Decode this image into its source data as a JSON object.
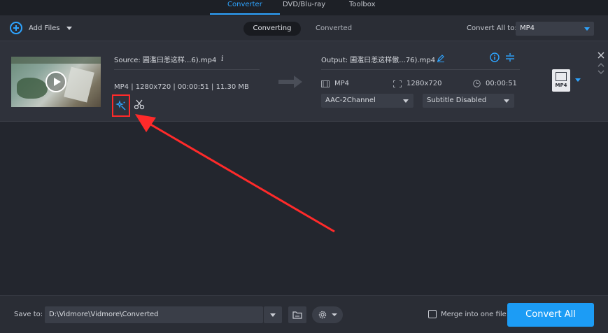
{
  "nav": {
    "tabs": [
      {
        "label": "Converter"
      },
      {
        "label": "DVD/Blu-ray"
      },
      {
        "label": "Toolbox"
      }
    ]
  },
  "toolbar": {
    "add_files_label": "Add Files",
    "segments": {
      "converting": "Converting",
      "converted": "Converted"
    },
    "convert_all_to_label": "Convert All to:",
    "convert_all_format": "MP4"
  },
  "file": {
    "source_name": "Source: 圃濫曰恙这样...6).mp4",
    "source_meta": "MP4 | 1280x720 | 00:00:51 | 11.30 MB",
    "output_name": "Output: 圃濫曰恙这样傲...76).mp4",
    "output_format": "MP4",
    "output_resolution": "1280x720",
    "output_duration": "00:00:51",
    "audio_track": "AAC-2Channel",
    "subtitle": "Subtitle Disabled",
    "format_badge": "MP4"
  },
  "bottom": {
    "save_to_label": "Save to:",
    "save_path": "D:\\Vidmore\\Vidmore\\Converted",
    "merge_label": "Merge into one file",
    "convert_all_label": "Convert All"
  },
  "colors": {
    "accent": "#2ea4ff",
    "annotation": "#ff2a2a",
    "convert_button": "#1c9cf5"
  }
}
